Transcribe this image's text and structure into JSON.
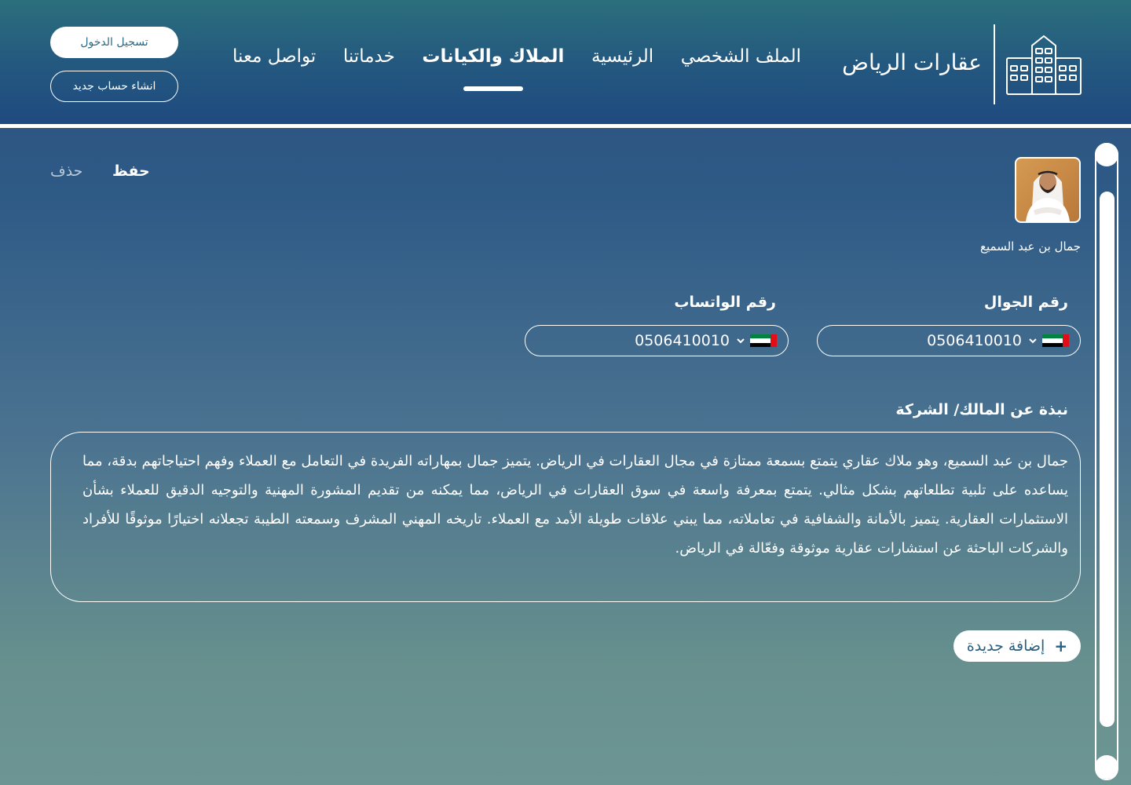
{
  "brand": {
    "name": "عقارات الرياض",
    "logo_icon": "buildings-icon"
  },
  "nav": {
    "items": [
      {
        "label": "الملف الشخصي",
        "active": false
      },
      {
        "label": "الرئيسية",
        "active": false
      },
      {
        "label": "الملاك والكيانات",
        "active": true
      },
      {
        "label": "خدماتنا",
        "active": false
      },
      {
        "label": "تواصل معنا",
        "active": false
      }
    ]
  },
  "auth": {
    "login_label": "تسجيل الدخول",
    "signup_label": "انشاء حساب جديد"
  },
  "owner": {
    "name": "جمال بن عبد السميع",
    "avatar_icon": "owner-avatar"
  },
  "actions": {
    "save_label": "حفظ",
    "delete_label": "حذف",
    "add_new_label": "إضافة جديدة",
    "add_icon": "+"
  },
  "fields": {
    "mobile": {
      "label": "رقم الجوال",
      "value": "0506410010",
      "country_flag": "uae-flag"
    },
    "whatsapp": {
      "label": "رقم الواتساب",
      "value": "0506410010",
      "country_flag": "uae-flag"
    }
  },
  "about": {
    "label": "نبذة عن المالك/ الشركة",
    "text": "جمال بن عبد السميع، وهو ملاك عقاري يتمتع بسمعة ممتازة في مجال العقارات في الرياض. يتميز جمال بمهاراته الفريدة في التعامل مع العملاء وفهم احتياجاتهم بدقة، مما يساعده على تلبية تطلعاتهم بشكل مثالي. يتمتع بمعرفة واسعة في سوق العقارات في الرياض، مما يمكنه من تقديم المشورة المهنية والتوجيه الدقيق للعملاء بشأن الاستثمارات العقارية. يتميز بالأمانة والشفافية في تعاملاته، مما يبني علاقات طويلة الأمد مع العملاء. تاريخه المهني المشرف وسمعته الطيبة تجعلانه اختيارًا موثوقًا للأفراد والشركات الباحثة عن استشارات عقارية موثوقة وفعّالة في الرياض."
  },
  "colors": {
    "header_top": "#2b6f7c",
    "header_bottom": "#1f4a80",
    "accent_text": "#2a6a86"
  }
}
